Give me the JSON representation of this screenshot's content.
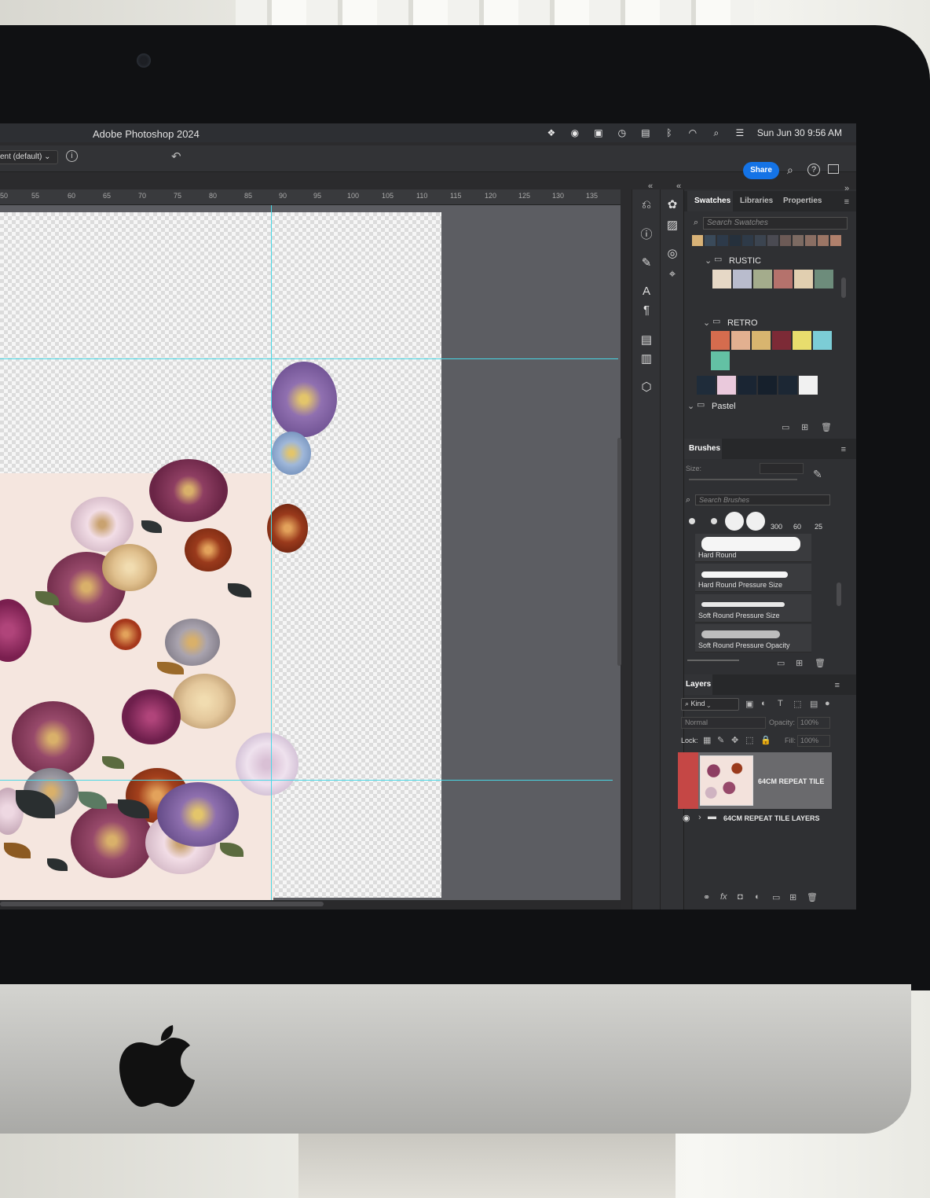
{
  "app": {
    "title": "Adobe Photoshop 2024",
    "preset": "ent (default)",
    "share_label": "Share"
  },
  "menubar": {
    "datetime": "Sun Jun 30  9:56 AM",
    "icons": [
      "dropbox-icon",
      "screen-record-icon",
      "screen-mirroring-icon",
      "time-machine-icon",
      "menu-extra-icon",
      "bluetooth-icon",
      "wifi-icon",
      "spotlight-search-icon",
      "control-center-icon"
    ]
  },
  "ruler": {
    "ticks": [
      "50",
      "55",
      "60",
      "65",
      "70",
      "75",
      "80",
      "85",
      "90",
      "95",
      "100",
      "105",
      "110",
      "115",
      "120",
      "125",
      "130",
      "135"
    ]
  },
  "swatches_panel": {
    "tabs": [
      "Swatches",
      "Libraries",
      "Properties"
    ],
    "search_placeholder": "Search Swatches",
    "recent_colors": [
      "#d8b277",
      "#3a4a5a",
      "#2d3a4a",
      "#25303c",
      "#2e3a48",
      "#3b4450",
      "#4a4a52",
      "#6c5a56",
      "#7c6a62",
      "#8a6e63",
      "#9b7565",
      "#b0806c"
    ],
    "groups": [
      {
        "name": "RUSTIC",
        "colors": [
          "#e6d8c6",
          "#b9bccd",
          "#a4ac8c",
          "#b5726c",
          "#e1cfb0",
          "#6d8c7b"
        ]
      },
      {
        "name": "RETRO",
        "colors": [
          "#d56c4e",
          "#e2b090",
          "#d8b56f",
          "#7c2a36",
          "#e8dd6d",
          "#7ccdd6",
          "#63c1a4"
        ],
        "extra": [
          "#1f2c3a",
          "#eac9dc",
          "#1a2533",
          "#16202c",
          "#1c2734",
          "#f1f1f1"
        ]
      },
      {
        "name": "Pastel",
        "colors": []
      }
    ]
  },
  "brushes_panel": {
    "title": "Brushes",
    "size_label": "Size:",
    "search_placeholder": "Search Brushes",
    "preset_sizes": [
      "300",
      "60",
      "25"
    ],
    "items": [
      "Hard Round",
      "Hard Round Pressure Size",
      "Soft Round Pressure Size",
      "Soft Round Pressure Opacity"
    ]
  },
  "layers_panel": {
    "title": "Layers",
    "filter_label": "Kind",
    "blend_mode": "Normal",
    "opacity_label": "Opacity:",
    "opacity_value": "100%",
    "lock_label": "Lock:",
    "fill_label": "Fill:",
    "fill_value": "100%",
    "layers": [
      {
        "name": "64CM REPEAT TILE",
        "type": "smart-object"
      },
      {
        "name": "64CM REPEAT TILE LAYERS",
        "type": "group"
      }
    ]
  },
  "colors": {
    "share_blue": "#1473e6",
    "guide_cyan": "#48d8e6",
    "panel_bg": "#2f3033",
    "layer_highlight": "#c54745"
  }
}
